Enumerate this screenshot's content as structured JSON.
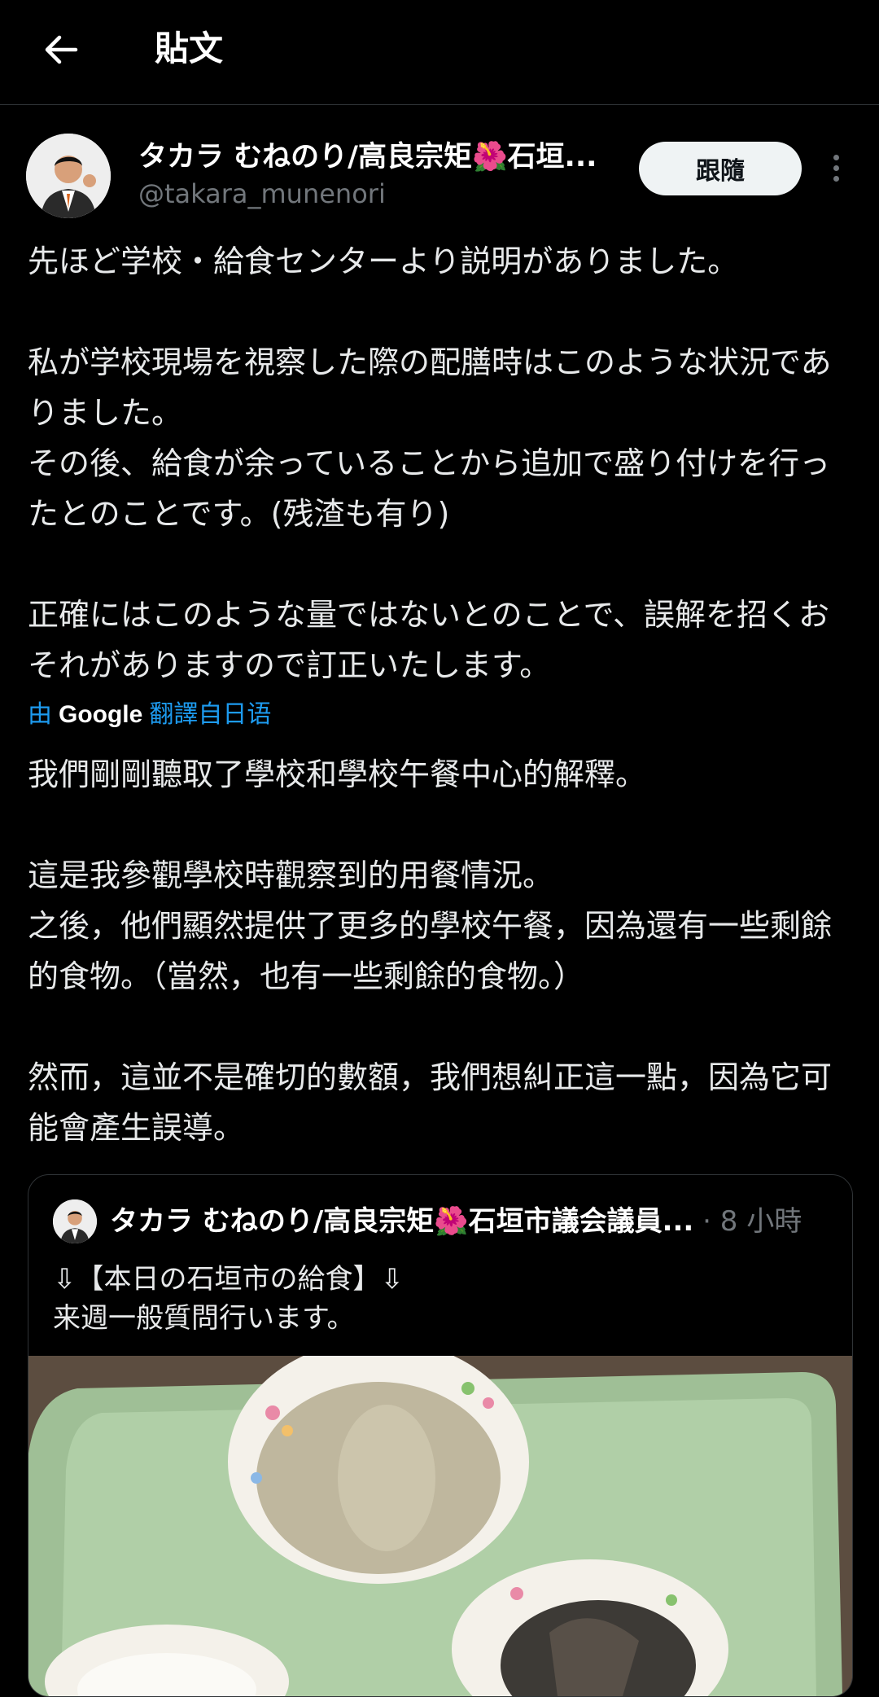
{
  "header": {
    "title": "貼文"
  },
  "author": {
    "name": "タカラ むねのり/高良宗矩🌺石垣...",
    "handle": "@takara_munenori",
    "follow_label": "跟隨"
  },
  "post": {
    "original_text": "先ほど学校・給食センターより説明がありました。\n\n私が学校現場を視察した際の配膳時はこのような状況でありました。\nその後、給食が余っていることから追加で盛り付けを行ったとのことです。(残渣も有り)\n\n正確にはこのような量ではないとのことで、誤解を招くおそれがありますので訂正いたします。",
    "translation_by": "由",
    "translation_provider": "Google",
    "translation_source": "翻譯自日语",
    "translated_text": "我們剛剛聽取了學校和學校午餐中心的解釋。\n\n這是我參觀學校時觀察到的用餐情況。\n之後，他們顯然提供了更多的學校午餐，因為還有一些剩餘的食物。（當然，也有一些剩餘的食物。）\n\n然而，這並不是確切的數額，我們想糾正這一點，因為它可能會產生誤導。"
  },
  "quote": {
    "name": "タカラ むねのり/高良宗矩🌺石垣市議会議員...",
    "separator": "·",
    "time": "8 小時",
    "text": "⇩【本日の石垣市の給食】⇩\n来週一般質問行います。"
  },
  "colors": {
    "background": "#000000",
    "text": "#e7e9ea",
    "secondary": "#71767b",
    "link": "#1d9bf0",
    "border": "#2f3336"
  }
}
